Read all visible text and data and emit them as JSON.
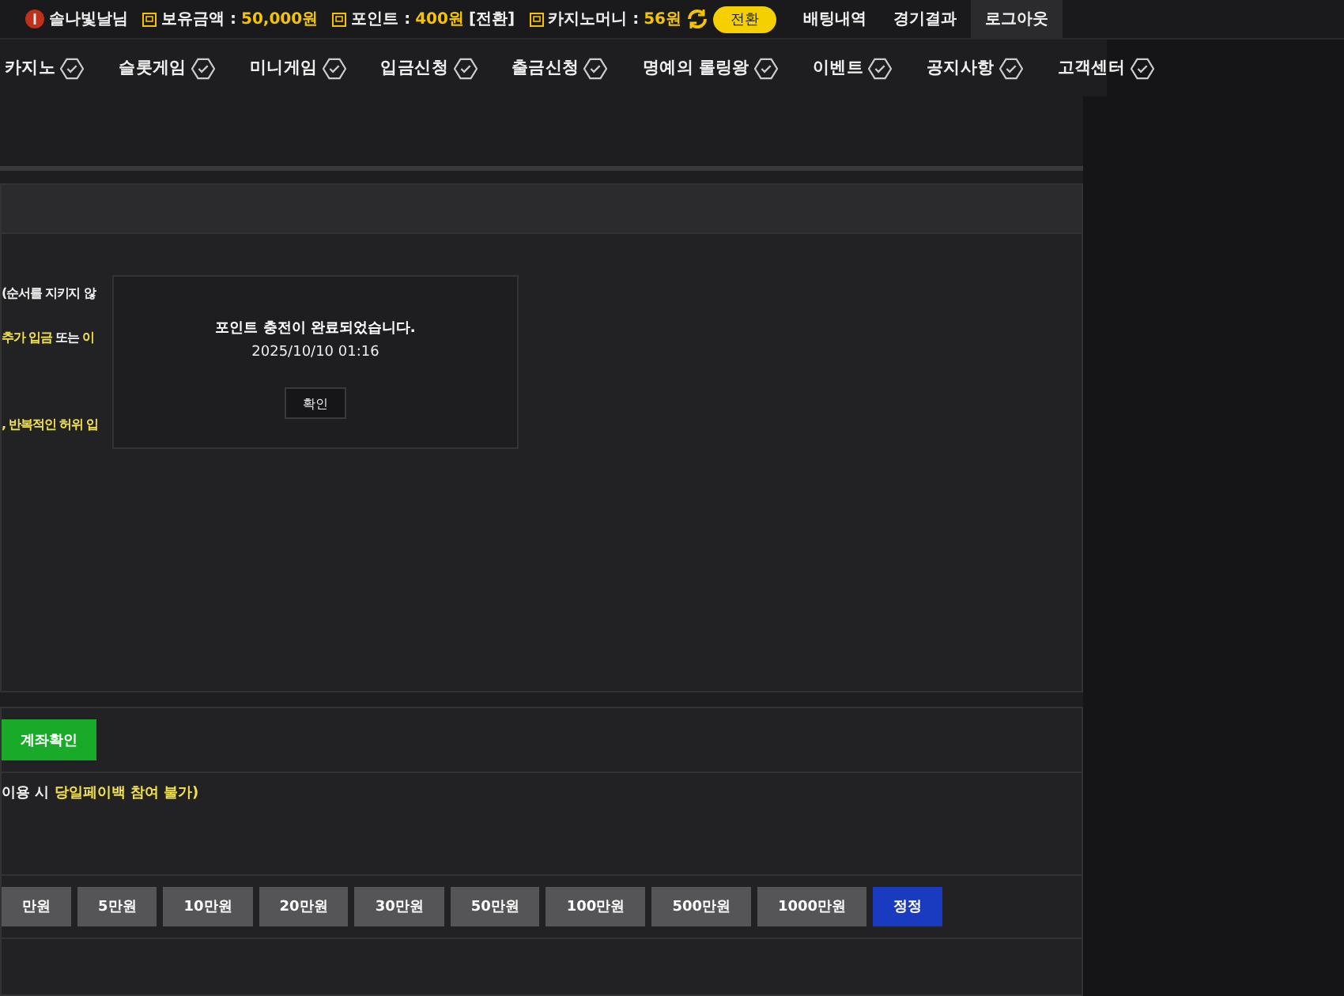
{
  "top_bar": {
    "username": "솔나빛날님",
    "balance_label": "보유금액 :",
    "balance": "50,000원",
    "point_label": "포인트 :",
    "point": "400원",
    "point_convert": "[전환]",
    "casino_label": "카지노머니 :",
    "casino": "56원",
    "convert_button": "전환",
    "links": [
      "배팅내역",
      "경기결과"
    ],
    "logout": "로그아웃"
  },
  "nav": [
    "카지노",
    "슬롯게임",
    "미니게임",
    "입금신청",
    "출금신청",
    "명예의 롤링왕",
    "이벤트",
    "공지사항",
    "고객센터"
  ],
  "notice_lines": [
    [
      {
        "kind": "plain",
        "text": "(순서를 지키지 않"
      }
    ],
    [
      {
        "kind": "highlight",
        "text": "추가 입금"
      },
      {
        "kind": "plain",
        "text": " 또는 "
      },
      {
        "kind": "highlight",
        "text": "이"
      }
    ],
    [
      {
        "kind": "highlight",
        "text": ", 반복적인 허위 입"
      }
    ]
  ],
  "modal": {
    "message": "포인트 충전이 완료되었습니다.",
    "time": "2025/10/10 01:16",
    "button": "확인"
  },
  "account_button": "계좌확인",
  "payback_note": [
    {
      "kind": "plain",
      "text": "이용 시 "
    },
    {
      "kind": "highlight",
      "text": "당일페이백 참여 불가)"
    }
  ],
  "amount_buttons": [
    {
      "kind": "amount",
      "label": "만원"
    },
    {
      "kind": "amount",
      "label": "5만원"
    },
    {
      "kind": "amount",
      "label": "10만원"
    },
    {
      "kind": "amount",
      "label": "20만원"
    },
    {
      "kind": "amount",
      "label": "30만원"
    },
    {
      "kind": "amount",
      "label": "50만원"
    },
    {
      "kind": "amount",
      "label": "100만원"
    },
    {
      "kind": "amount",
      "label": "500만원"
    },
    {
      "kind": "amount",
      "label": "1000만원"
    },
    {
      "kind": "reset",
      "label": "정정"
    }
  ]
}
